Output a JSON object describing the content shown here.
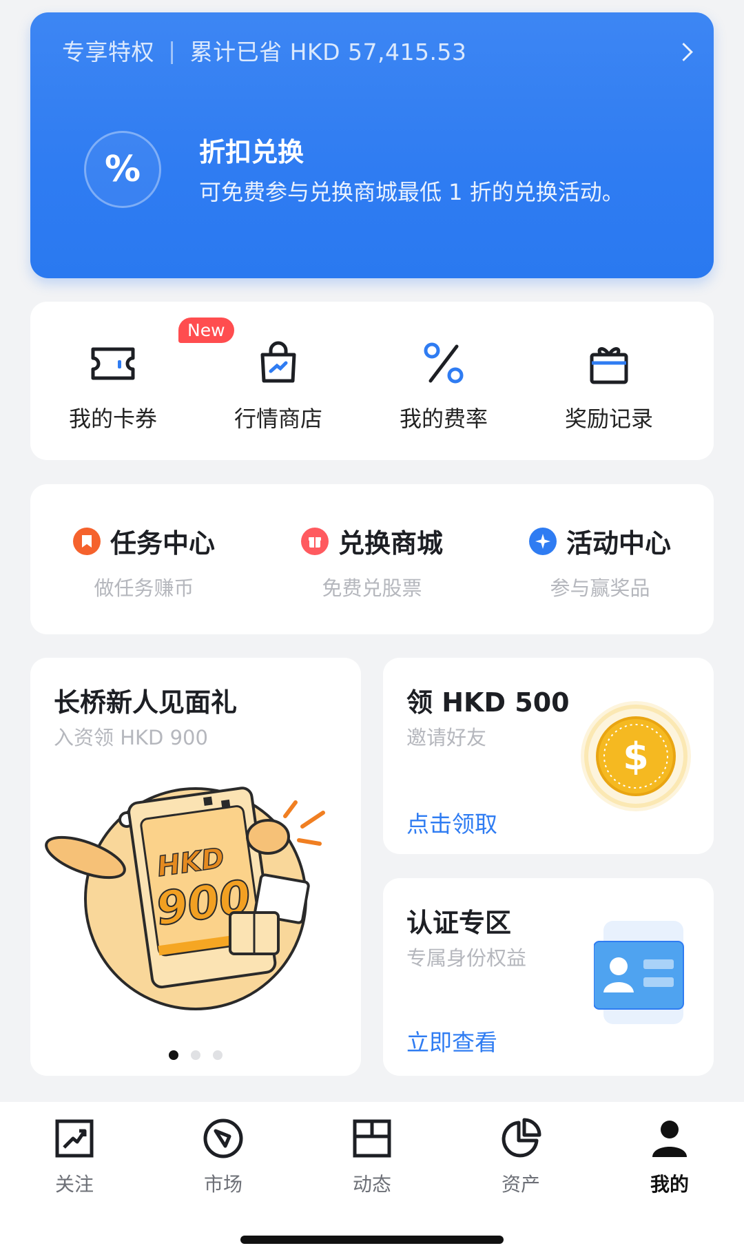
{
  "banner": {
    "left_label": "专享特权",
    "savings": "累计已省 HKD 57,415.53",
    "icon_symbol": "%",
    "title": "折扣兑换",
    "description": "可免费参与兑换商城最低 1 折的兑换活动。"
  },
  "quick_actions": [
    {
      "label": "我的卡券",
      "icon": "coupon-icon",
      "badge": "New"
    },
    {
      "label": "行情商店",
      "icon": "shopping-bag-icon"
    },
    {
      "label": "我的费率",
      "icon": "percent-icon"
    },
    {
      "label": "奖励记录",
      "icon": "gift-icon"
    }
  ],
  "centers": [
    {
      "title": "任务中心",
      "subtitle": "做任务赚币",
      "icon": "bookmark-icon",
      "color": "#f5622d"
    },
    {
      "title": "兑换商城",
      "subtitle": "免费兑股票",
      "icon": "gift-icon",
      "color": "#ff5a5f"
    },
    {
      "title": "活动中心",
      "subtitle": "参与赢奖品",
      "icon": "sparkle-icon",
      "color": "#2f7cf2"
    }
  ],
  "promo": {
    "title": "长桥新人见面礼",
    "subtitle": "入资领 HKD 900",
    "illustration_text": [
      "HKD",
      "900"
    ],
    "pages": 3,
    "active_page": 1
  },
  "invite": {
    "title": "领 HKD 500",
    "subtitle": "邀请好友",
    "link": "点击领取",
    "icon": "dollar-coin-icon"
  },
  "verify": {
    "title": "认证专区",
    "subtitle": "专属身份权益",
    "link": "立即查看",
    "icon": "id-card-icon"
  },
  "tabs": [
    {
      "label": "关注",
      "icon": "watchlist-icon"
    },
    {
      "label": "市场",
      "icon": "compass-icon"
    },
    {
      "label": "动态",
      "icon": "layout-icon"
    },
    {
      "label": "资产",
      "icon": "pie-chart-icon"
    },
    {
      "label": "我的",
      "icon": "user-icon",
      "active": true
    }
  ],
  "colors": {
    "accent": "#2f7cf2",
    "badge": "#ff4d4f",
    "coin": "#f5b921"
  }
}
